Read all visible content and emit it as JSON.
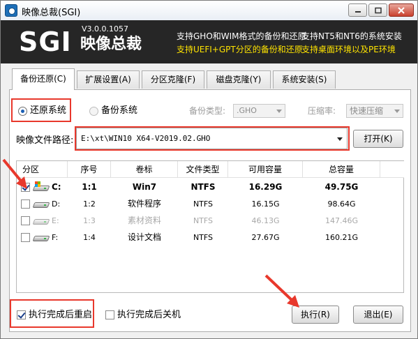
{
  "window": {
    "title": "映像总裁(SGI)"
  },
  "banner": {
    "logo": "SGI",
    "version": "V3.0.0.1057",
    "product_name": "映像总裁",
    "features": [
      "支持GHO和WIM格式的备份和还原",
      "支持UEFI+GPT分区的备份和还原",
      "支持NT5和NT6的系统安装",
      "支持桌面环境以及PE环境"
    ],
    "feature_colors": {
      "primary": "#ffffff",
      "highlight": "#ffe400"
    }
  },
  "tabs": [
    {
      "label": "备份还原(C)",
      "active": true
    },
    {
      "label": "扩展设置(A)",
      "active": false
    },
    {
      "label": "分区克隆(F)",
      "active": false
    },
    {
      "label": "磁盘克隆(Y)",
      "active": false
    },
    {
      "label": "系统安装(S)",
      "active": false
    }
  ],
  "options": {
    "restore_label": "还原系统",
    "backup_label": "备份系统",
    "backup_type_label": "备份类型:",
    "backup_type_value": ".GHO",
    "compression_label": "压缩率:",
    "compression_value": "快速压缩"
  },
  "path": {
    "label": "映像文件路径:",
    "value": "E:\\xt\\WIN10 X64-V2019.02.GHO",
    "open_button": "打开(K)"
  },
  "table": {
    "headers": [
      "分区",
      "序号",
      "卷标",
      "文件类型",
      "可用容量",
      "总容量"
    ],
    "rows": [
      {
        "drive": "C:",
        "index": "1:1",
        "label": "Win7",
        "fs": "NTFS",
        "free": "16.29G",
        "total": "49.75G",
        "checked": true,
        "style": "bold"
      },
      {
        "drive": "D:",
        "index": "1:2",
        "label": "软件程序",
        "fs": "NTFS",
        "free": "16.15G",
        "total": "98.64G",
        "checked": false,
        "style": "normal"
      },
      {
        "drive": "E:",
        "index": "1:3",
        "label": "素材资料",
        "fs": "NTFS",
        "free": "46.13G",
        "total": "147.46G",
        "checked": false,
        "style": "gray"
      },
      {
        "drive": "F:",
        "index": "1:4",
        "label": "设计文档",
        "fs": "NTFS",
        "free": "27.67G",
        "total": "160.21G",
        "checked": false,
        "style": "normal"
      }
    ]
  },
  "footer": {
    "reboot_label": "执行完成后重启",
    "reboot_checked": true,
    "shutdown_label": "执行完成后关机",
    "shutdown_checked": false,
    "execute_button": "执行(R)",
    "exit_button": "退出(E)"
  },
  "colors": {
    "annotation": "#e8382c",
    "banner_bg": "#262626"
  }
}
